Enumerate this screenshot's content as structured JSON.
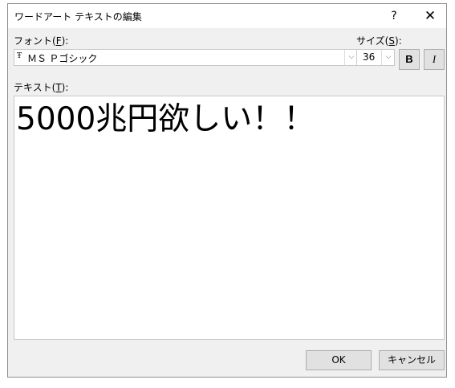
{
  "window": {
    "title": "ワードアート テキストの編集",
    "help_glyph": "?",
    "close_glyph": "✕"
  },
  "font": {
    "label_prefix": "フォント(",
    "label_key": "F",
    "label_suffix": "):",
    "icon_glyph": "Ŧ",
    "value": "ＭＳ Ｐゴシック",
    "arrow_glyph": "⌵"
  },
  "size": {
    "label_prefix": "サイズ(",
    "label_key": "S",
    "label_suffix": "):",
    "value": "36",
    "arrow_glyph": "⌵"
  },
  "format": {
    "bold_label": "B",
    "italic_label": "I"
  },
  "text": {
    "label_prefix": "テキスト(",
    "label_key": "T",
    "label_suffix": "):",
    "content": "5000兆円欲しい！！"
  },
  "buttons": {
    "ok_label": "OK",
    "cancel_label": "キャンセル"
  }
}
